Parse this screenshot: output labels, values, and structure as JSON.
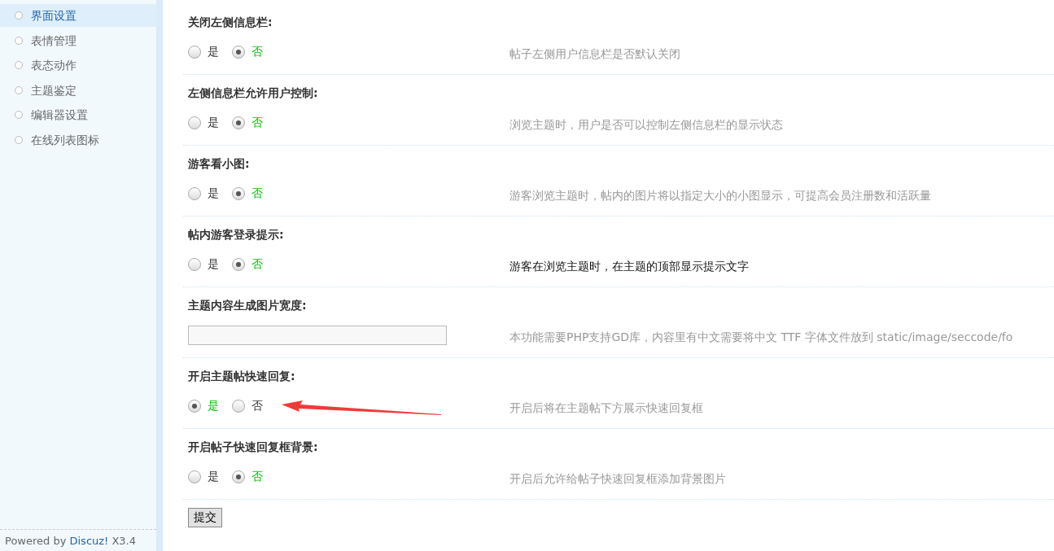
{
  "sidebar": {
    "items": [
      {
        "label": "界面设置",
        "selected": true
      },
      {
        "label": "表情管理",
        "selected": false
      },
      {
        "label": "表态动作",
        "selected": false
      },
      {
        "label": "主题鉴定",
        "selected": false
      },
      {
        "label": "编辑器设置",
        "selected": false
      },
      {
        "label": "在线列表图标",
        "selected": false
      }
    ],
    "footer": {
      "prefix": "Powered by ",
      "link": "Discuz!",
      "suffix": " X3.4"
    }
  },
  "settings": [
    {
      "kind": "radio",
      "label": "关闭左侧信息栏:",
      "options": [
        {
          "label": "是",
          "selected": false
        },
        {
          "label": "否",
          "selected": true
        }
      ],
      "description": "帖子左侧用户信息栏是否默认关闭",
      "emphasized": false,
      "annotated": false
    },
    {
      "kind": "radio",
      "label": "左侧信息栏允许用户控制:",
      "options": [
        {
          "label": "是",
          "selected": false
        },
        {
          "label": "否",
          "selected": true
        }
      ],
      "description": "浏览主题时，用户是否可以控制左侧信息栏的显示状态",
      "emphasized": false,
      "annotated": false
    },
    {
      "kind": "radio",
      "label": "游客看小图:",
      "options": [
        {
          "label": "是",
          "selected": false
        },
        {
          "label": "否",
          "selected": true
        }
      ],
      "description": "游客浏览主题时，帖内的图片将以指定大小的小图显示，可提高会员注册数和活跃量",
      "emphasized": false,
      "annotated": false
    },
    {
      "kind": "radio",
      "label": "帖内游客登录提示:",
      "options": [
        {
          "label": "是",
          "selected": false
        },
        {
          "label": "否",
          "selected": true
        }
      ],
      "description": "游客在浏览主题时，在主题的顶部显示提示文字",
      "emphasized": true,
      "annotated": false
    },
    {
      "kind": "text",
      "label": "主题内容生成图片宽度:",
      "description": "本功能需要PHP支持GD库，内容里有中文需要将中文 TTF 字体文件放到 static/image/seccode/fo",
      "emphasized": false,
      "annotated": false
    },
    {
      "kind": "radio",
      "label": "开启主题帖快速回复:",
      "options": [
        {
          "label": "是",
          "selected": true
        },
        {
          "label": "否",
          "selected": false
        }
      ],
      "description": "开启后将在主题帖下方展示快速回复框",
      "emphasized": false,
      "annotated": true
    },
    {
      "kind": "radio",
      "label": "开启帖子快速回复框背景:",
      "options": [
        {
          "label": "是",
          "selected": false
        },
        {
          "label": "否",
          "selected": true
        }
      ],
      "description": "开启后允许给帖子快速回复框添加背景图片",
      "emphasized": false,
      "annotated": false
    }
  ],
  "submit": "提交"
}
